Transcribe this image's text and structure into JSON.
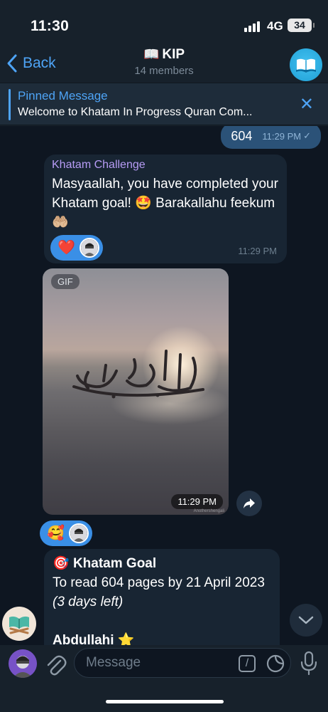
{
  "status": {
    "time": "11:30",
    "network": "4G",
    "battery": "34"
  },
  "header": {
    "back_label": "Back",
    "title_icon": "📖",
    "title": "KIP",
    "subtitle": "14 members"
  },
  "pinned": {
    "title": "Pinned Message",
    "text": "Welcome to Khatam In Progress Quran Com..."
  },
  "messages": {
    "outgoing": {
      "text": "604",
      "time": "11:29 PM"
    },
    "challenge": {
      "sender": "Khatam Challenge",
      "text": "Masyaallah, you have completed your Khatam goal! 🤩 Barakallahu feekum 🤲🏼",
      "reaction_emoji": "❤️",
      "time": "11:29 PM"
    },
    "gif": {
      "tag": "GIF",
      "time": "11:29 PM",
      "watermark": "Anothershengali"
    },
    "gif_reaction_emoji": "🥰",
    "goal": {
      "icon": "🎯",
      "title": "Khatam Goal",
      "line1": "To read 604 pages by 21 April 2023 ",
      "line2_italic": "(3 days left)",
      "name": "Abdullahi",
      "name_icon": "⭐"
    }
  },
  "input": {
    "placeholder": "Message",
    "command_label": "/"
  },
  "colors": {
    "accent": "#4ea4f6",
    "sender": "#b79cf5",
    "outgoing_bubble": "#2b5278",
    "incoming_bubble": "#182533",
    "reaction_pill": "#3a8fe6"
  }
}
